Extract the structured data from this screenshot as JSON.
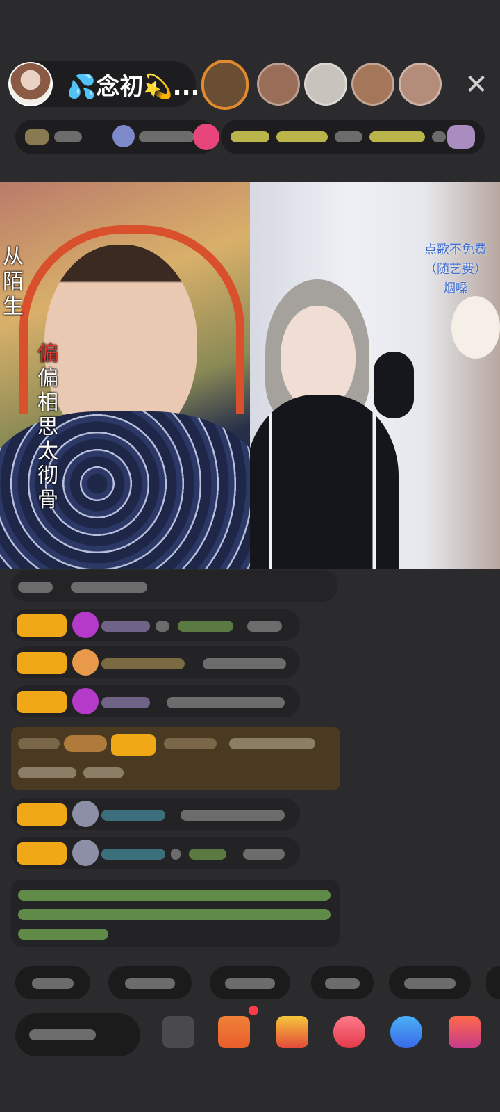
{
  "host": {
    "name": "💦念初💫...",
    "avatar_icon": "host-avatar"
  },
  "top_viewers": [
    {
      "color": "#7a5a3a"
    },
    {
      "color": "#9a6d58"
    },
    {
      "color": "#c9c3bd"
    },
    {
      "color": "#a4765a"
    },
    {
      "color": "#b48c7a"
    }
  ],
  "close_icon": "✕",
  "video": {
    "left_streamer_tag": "从陌生",
    "left_overlay_text_red": "偏",
    "left_overlay_text_rest": "偏相思太彻骨",
    "right_overlay_lines": [
      "点歌不免费",
      "（随艺费）",
      "烟嗓"
    ]
  },
  "colors": {
    "background": "#2b2b2d",
    "badge": "#f0a817",
    "highlight_bg": "#4a3a22",
    "notice_text": "#7fc15a",
    "red_accent": "#ff3b4a"
  }
}
